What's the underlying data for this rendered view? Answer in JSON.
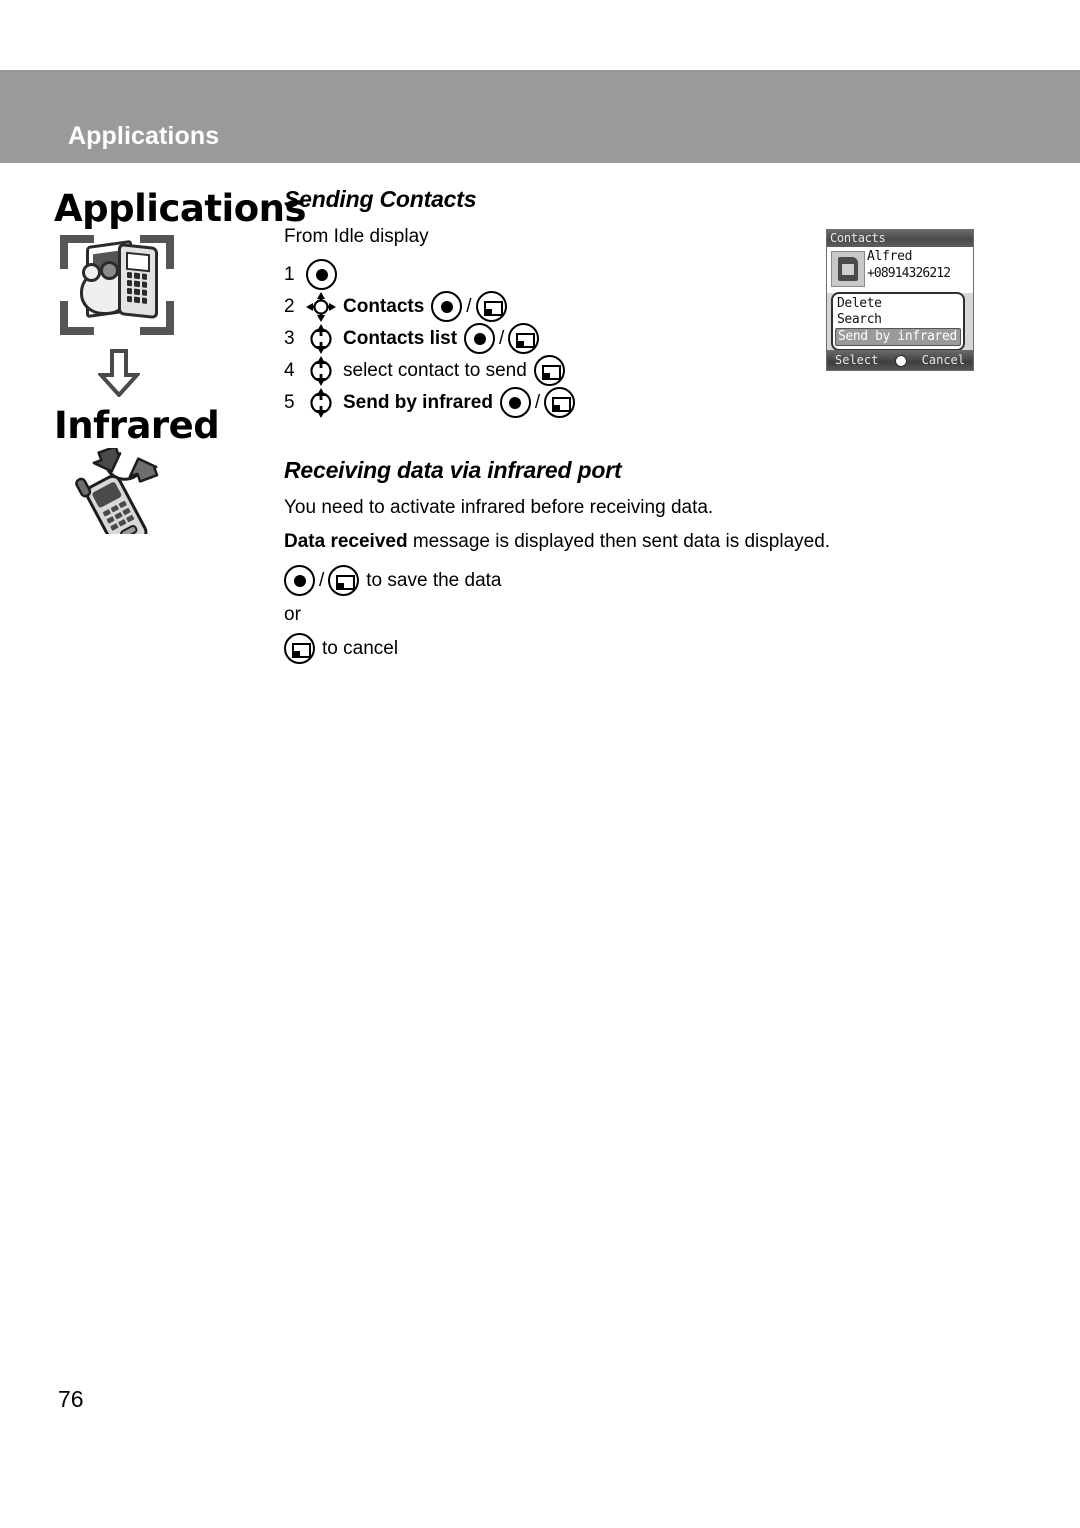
{
  "header": {
    "running_title": "Applications",
    "bar_color": "#9a9a9a"
  },
  "sidebar": {
    "title_applications": "Applications",
    "title_infrared": "Infrared",
    "icons": [
      {
        "name": "send-contacts-illustration",
        "label": "phone and camera in focus brackets"
      },
      {
        "name": "down-arrow-icon",
        "label": "downward arrow"
      },
      {
        "name": "infrared-phone-illustration",
        "label": "mobile phone with infrared exchange arrows"
      }
    ]
  },
  "main": {
    "section1": {
      "heading": "Sending Contacts",
      "intro": "From Idle display",
      "steps": [
        {
          "num": "1",
          "nav": "",
          "label": "",
          "keys": [
            "ok"
          ]
        },
        {
          "num": "2",
          "nav": "nav4",
          "label": "Contacts",
          "bold": true,
          "keys": [
            "ok",
            "soft"
          ]
        },
        {
          "num": "3",
          "nav": "nav2",
          "label": "Contacts list",
          "bold": true,
          "keys": [
            "ok",
            "soft"
          ]
        },
        {
          "num": "4",
          "nav": "nav2",
          "label": "select contact to send",
          "bold": false,
          "keys": [
            "soft"
          ]
        },
        {
          "num": "5",
          "nav": "nav2",
          "label": "Send by infrared",
          "bold": true,
          "keys": [
            "ok",
            "soft"
          ]
        }
      ],
      "slash": "/"
    },
    "section2": {
      "heading": "Receiving data via infrared port",
      "line1": "You need to activate infrared before receiving data.",
      "line2_bold": "Data received",
      "line2_rest": " message is displayed then sent data is displayed.",
      "save_text": "to save the data",
      "or_text": "or",
      "cancel_text": "to cancel",
      "slash": "/"
    }
  },
  "phone_screenshot": {
    "title": "Contacts",
    "contact_name": "Alfred",
    "contact_number": "+08914326212",
    "menu_items": [
      "Delete",
      "Search",
      "Send by infrared"
    ],
    "selected_menu_item": "Send by infrared",
    "softkey_left": "Select",
    "softkey_right": "Cancel"
  },
  "footer": {
    "page_number": "76"
  }
}
